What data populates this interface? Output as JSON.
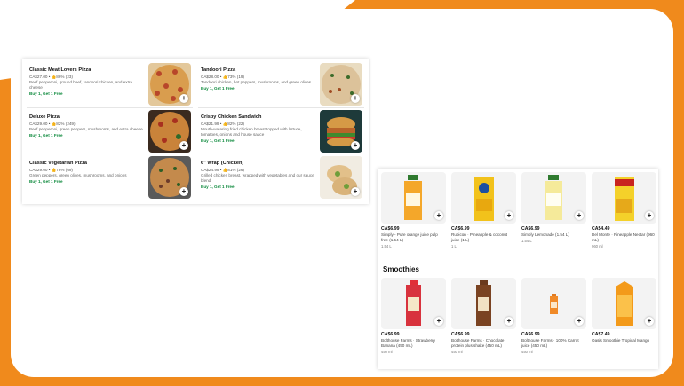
{
  "pizzas": [
    {
      "name": "Classic Meat Lovers Pizza",
      "meta": "CA$27.00 • 👍86% (23)",
      "desc": "Beef pepperoni, ground beef, tandoori chicken, and extra cheese",
      "promo": "Buy 1, Get 1 Free"
    },
    {
      "name": "Tandoori Pizza",
      "meta": "CA$28.00 • 👍73% (19)",
      "desc": "Tandoori chicken, hot peppers, mushrooms, and green olives",
      "promo": "Buy 1, Get 1 Free"
    },
    {
      "name": "Deluxe Pizza",
      "meta": "CA$29.00 • 👍82% (249)",
      "desc": "Beef pepperoni, green peppers, mushrooms, and extra cheese",
      "promo": "Buy 1, Get 1 Free"
    },
    {
      "name": "Crispy Chicken Sandwich",
      "meta": "CA$21.99 • 👍82% (22)",
      "desc": "Mouth-watering fried chicken breast topped with lettuce, tomatoes, onions and house sauce",
      "promo": "Buy 1, Get 1 Free"
    },
    {
      "name": "Classic Vegetarian Pizza",
      "meta": "CA$29.00 • 👍78% (69)",
      "desc": "Green peppers, green olives, mushrooms, and onions",
      "promo": "Buy 1, Get 1 Free"
    },
    {
      "name": "6\" Wrap (Chicken)",
      "meta": "CA$24.99 • 👍81% (26)",
      "desc": "Grilled chicken breast, wrapped with vegetables and our sauce blend",
      "promo": "Buy 1, Get 1 Free"
    }
  ],
  "drinks": [
    {
      "price": "CA$6.99",
      "name": "Simply - Pure orange juice pulp free (1.54 L)",
      "size": "1.54 L"
    },
    {
      "price": "CA$6.99",
      "name": "Rubicon · Pineapple & coconut juice (1 L)",
      "size": "1 L"
    },
    {
      "price": "CA$6.99",
      "name": "Simply Lemonade (1.54 L)",
      "size": "1.54 L"
    },
    {
      "price": "CA$4.49",
      "name": "Del Monte · Pineapple Nectar (960 mL)",
      "size": "960 ml"
    }
  ],
  "smoothies_title": "Smoothies",
  "smoothies": [
    {
      "price": "CA$6.99",
      "name": "Bolthouse Farms · Strawberry Banana (450 mL)",
      "size": "450 ml"
    },
    {
      "price": "CA$6.99",
      "name": "Bolthouse Farms · Chocolate protein plus shake (450 mL)",
      "size": "450 ml"
    },
    {
      "price": "CA$6.99",
      "name": "Bolthouse Farms · 100% Carrot juice (450 mL)",
      "size": "450 ml"
    },
    {
      "price": "CA$7.49",
      "name": "Oasis Smoothie Tropical Mango",
      "size": ""
    }
  ],
  "add_label": "+"
}
